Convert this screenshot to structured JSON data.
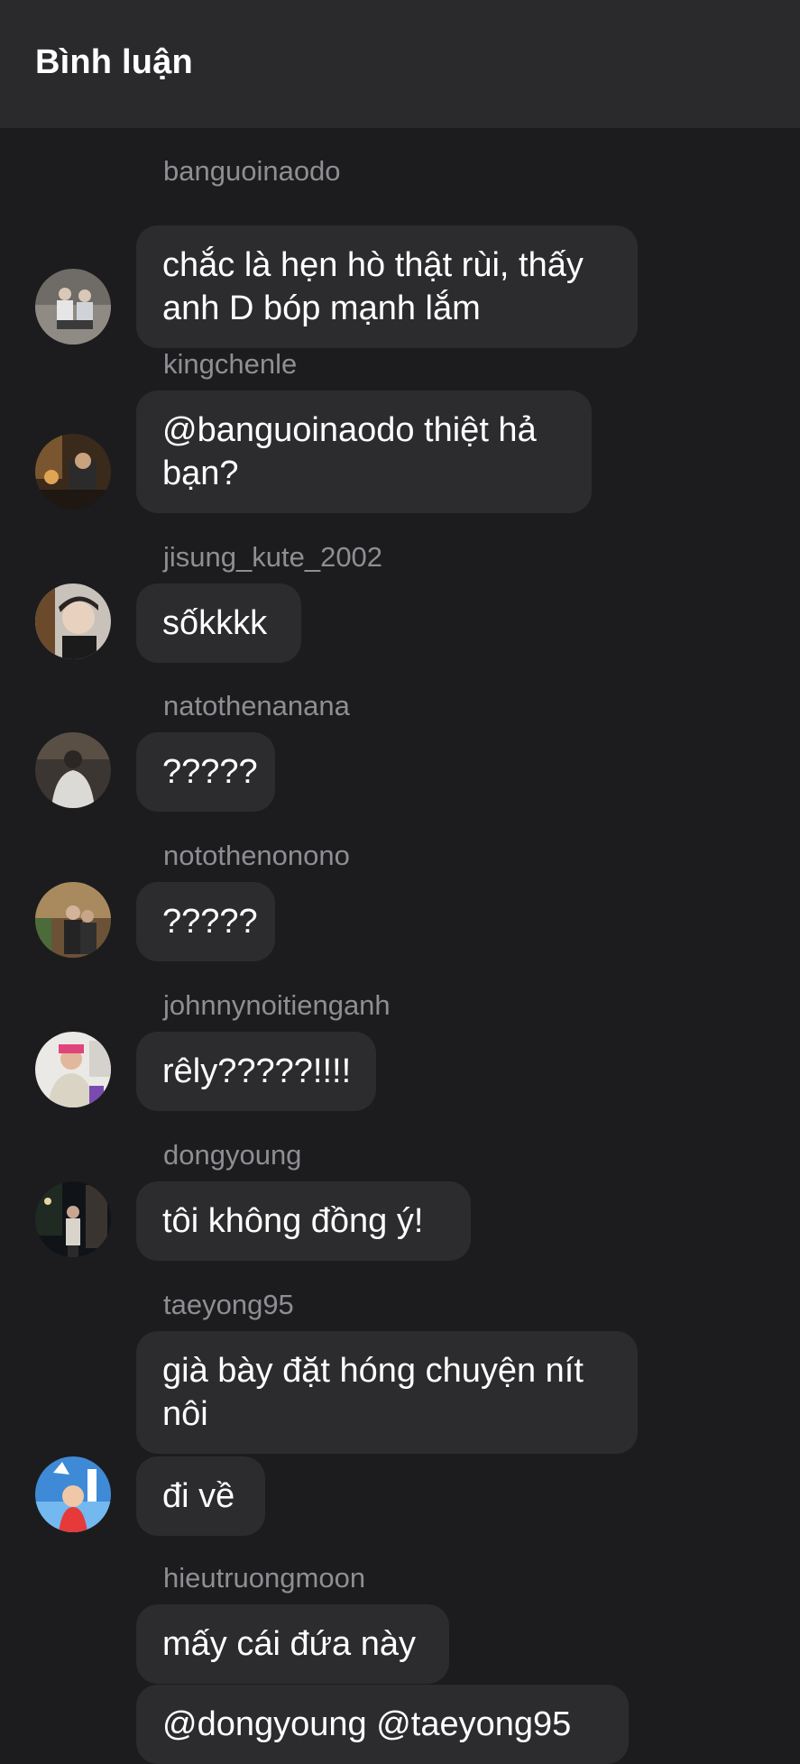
{
  "header": {
    "title": "Bình luận"
  },
  "comments": [
    {
      "username": "banguoinaodo",
      "messages": [
        "chắc là hẹn hò thật rùi, thấy\nanh D bóp mạnh lắm"
      ],
      "avatar": "avatar-banguoinaodo"
    },
    {
      "username": "kingchenle",
      "messages": [
        "@banguoinaodo thiệt hả\nbạn?"
      ],
      "avatar": "avatar-kingchenle"
    },
    {
      "username": "jisung_kute_2002",
      "messages": [
        "sốkkkk"
      ],
      "avatar": "avatar-jisung"
    },
    {
      "username": "natothenanana",
      "messages": [
        "?????"
      ],
      "avatar": "avatar-natothenanana"
    },
    {
      "username": "notothenonono",
      "messages": [
        "?????"
      ],
      "avatar": "avatar-notothenonono"
    },
    {
      "username": "johnnynoitienganh",
      "messages": [
        "rêly?????!!!!"
      ],
      "avatar": "avatar-johnny"
    },
    {
      "username": "dongyoung",
      "messages": [
        "tôi không đồng ý!"
      ],
      "avatar": "avatar-dongyoung"
    },
    {
      "username": "taeyong95",
      "messages": [
        "già bày đặt hóng chuyện nít\nnôi",
        "đi về"
      ],
      "avatar": "avatar-taeyong95"
    },
    {
      "username": "hieutruongmoon",
      "messages": [
        "mấy cái đứa này",
        "@dongyoung @taeyong95"
      ],
      "avatar": "avatar-hieutruongmoon"
    }
  ],
  "colors": {
    "background": "#1c1c1e",
    "header": "#2a2a2c",
    "bubble": "#2c2c2e",
    "username": "#8e8e93"
  }
}
